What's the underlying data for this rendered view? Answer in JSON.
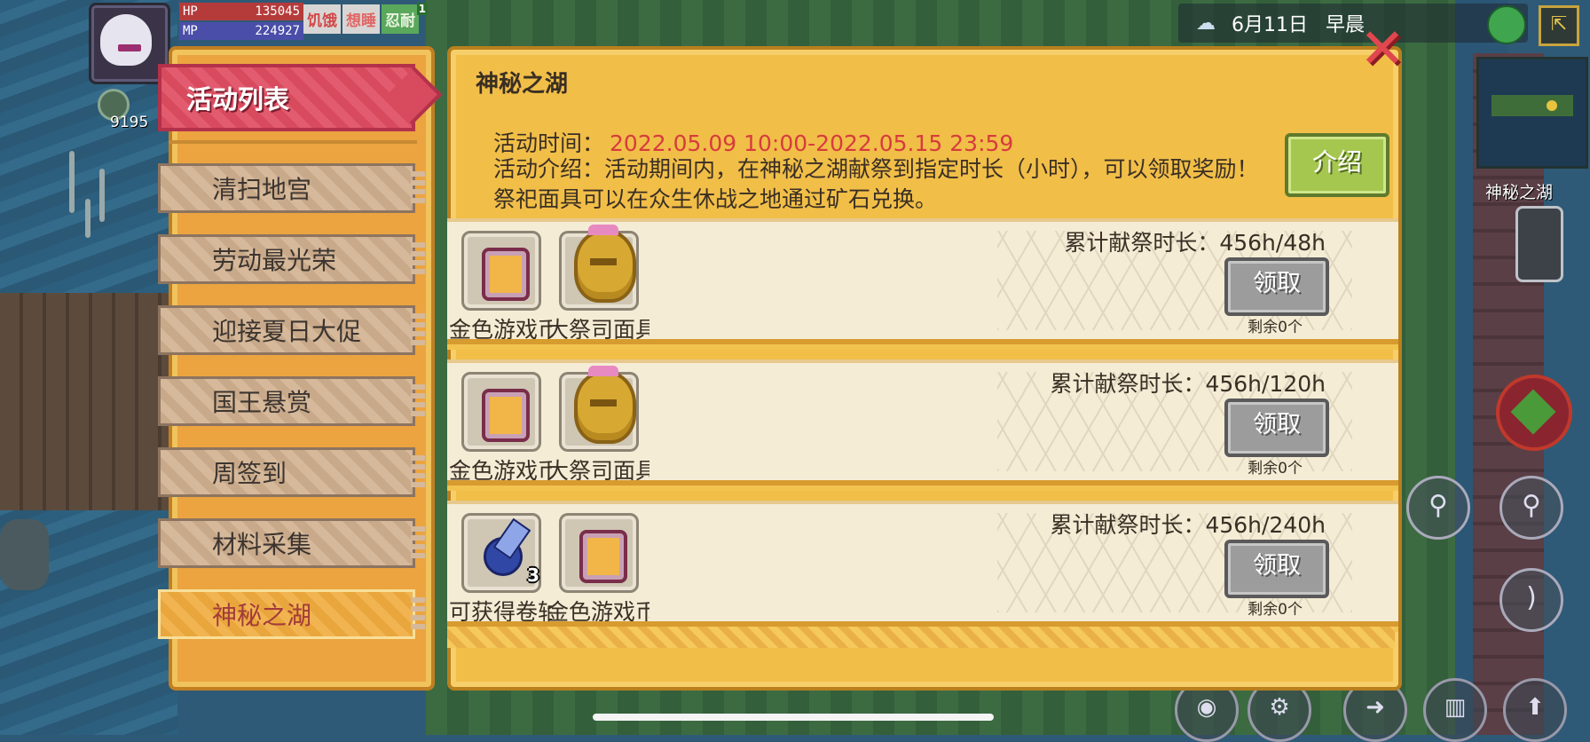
{
  "hud": {
    "hp_label": "HP",
    "hp_value": "135045",
    "mp_label": "MP",
    "mp_value": "224927",
    "status_1": "饥饿",
    "status_2": "想睡",
    "status_3": "忍耐",
    "status_3_badge": "1",
    "gem_count": "9195",
    "date": "6月11日",
    "period": "早晨",
    "minimap_label": "神秘之湖"
  },
  "tabs": {
    "header": "活动列表",
    "items": [
      {
        "label": "清扫地宫"
      },
      {
        "label": "劳动最光荣"
      },
      {
        "label": "迎接夏日大促"
      },
      {
        "label": "国王悬赏"
      },
      {
        "label": "周签到"
      },
      {
        "label": "材料采集"
      },
      {
        "label": "神秘之湖"
      }
    ],
    "active_index": 6
  },
  "event": {
    "title": "神秘之湖",
    "time_label": "活动时间：",
    "time_value": "2022.05.09 10:00-2022.05.15 23:59",
    "intro": "活动介绍：活动期间内，在神秘之湖献祭到指定时长（小时），可以领取奖励！祭祀面具可以在众生休战之地通过矿石兑换。",
    "intro_button": "介绍",
    "close": "✕"
  },
  "rows": [
    {
      "progress": "累计献祭时长：456h/48h",
      "claim": "领取",
      "remaining": "剩余0个",
      "rewards": [
        {
          "name": "金色游戏币",
          "icon": "gold-coin-icon",
          "qty": ""
        },
        {
          "name": "大祭司面具",
          "icon": "priest-mask-icon",
          "qty": ""
        }
      ]
    },
    {
      "progress": "累计献祭时长：456h/120h",
      "claim": "领取",
      "remaining": "剩余0个",
      "rewards": [
        {
          "name": "金色游戏币",
          "icon": "gold-coin-icon",
          "qty": ""
        },
        {
          "name": "大祭司面具",
          "icon": "priest-mask-icon",
          "qty": ""
        }
      ]
    },
    {
      "progress": "累计献祭时长：456h/240h",
      "claim": "领取",
      "remaining": "剩余0个",
      "rewards": [
        {
          "name": "可获得卷轴",
          "icon": "scroll-icon",
          "qty": "3"
        },
        {
          "name": "金色游戏币",
          "icon": "gold-coin-icon",
          "qty": ""
        }
      ]
    }
  ],
  "colors": {
    "panel": "#f1be48",
    "time_value": "#d63c3c",
    "intro_button": "#a5c750",
    "claim_button": "#9c9c9c",
    "active_tab": "#e9a63c",
    "tab_header": "#d84a5e"
  }
}
